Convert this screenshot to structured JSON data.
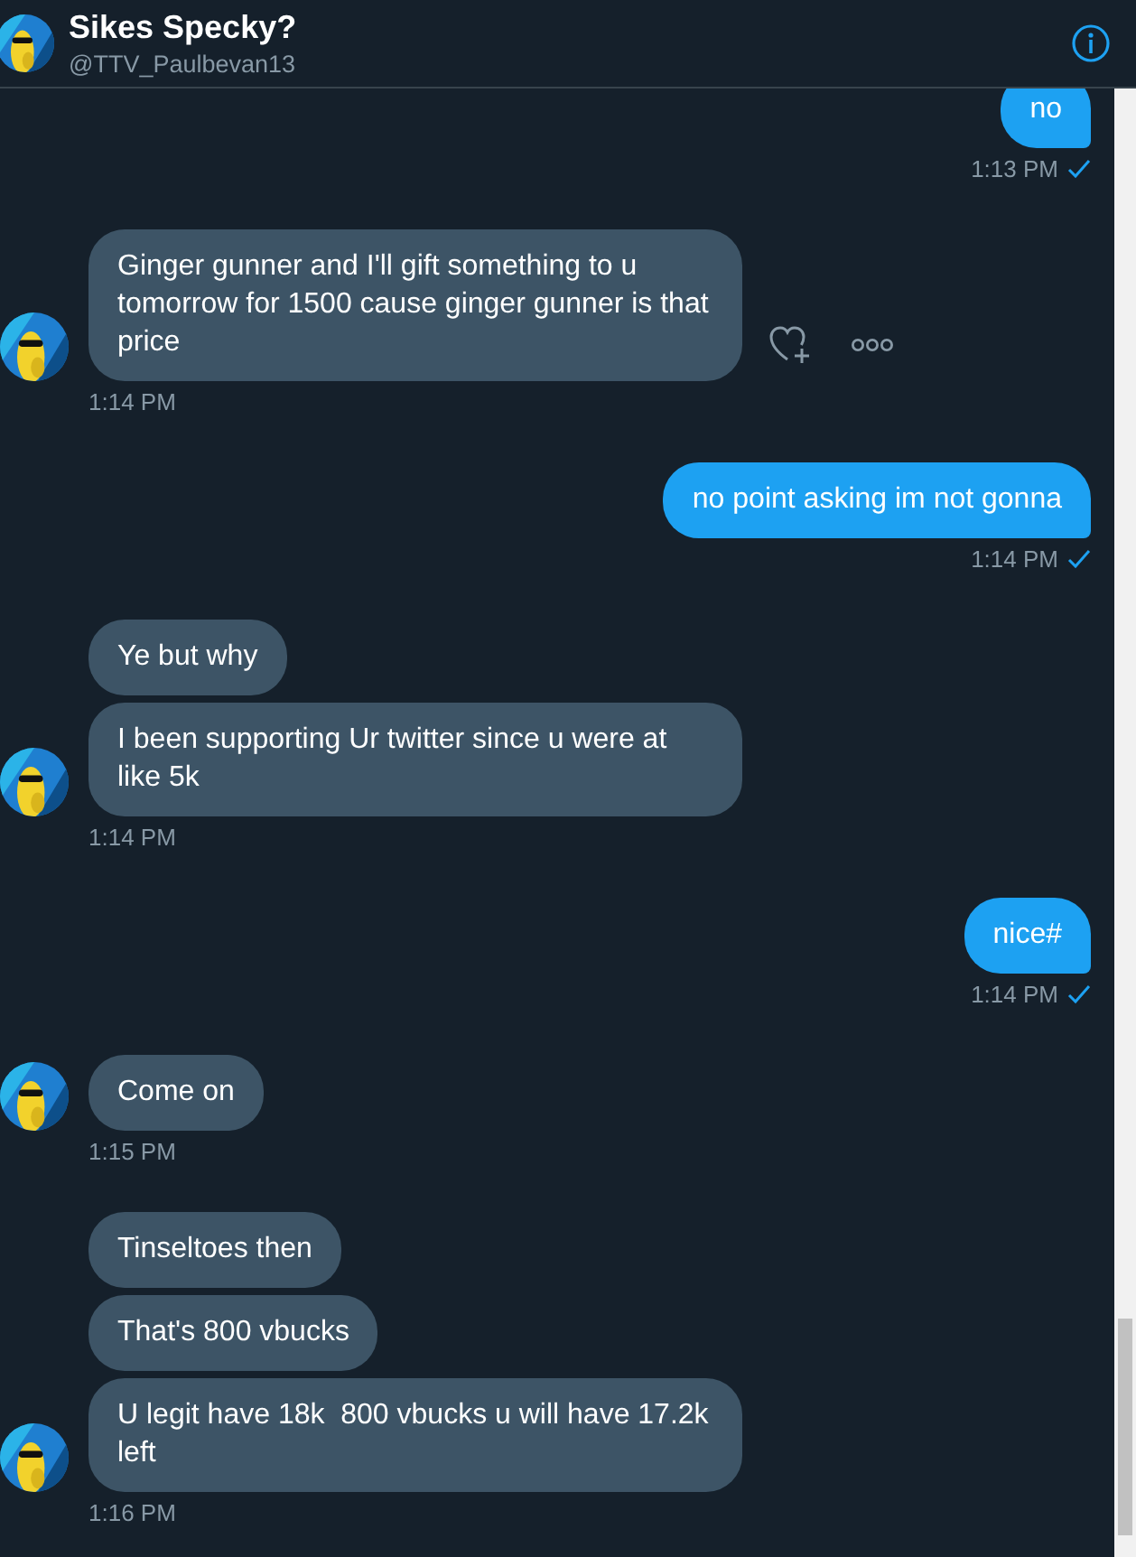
{
  "header": {
    "title": "Sikes Specky?",
    "handle": "@TTV_Paulbevan13"
  },
  "groups": [
    {
      "kind": "outgoing",
      "messages": [
        "no"
      ],
      "time": "1:13 PM",
      "read": true
    },
    {
      "kind": "incoming",
      "messages": [
        "Ginger gunner and I'll gift something to u tomorrow for 1500 cause ginger gunner is that price"
      ],
      "time": "1:14 PM",
      "hover_actions": true
    },
    {
      "kind": "outgoing",
      "messages": [
        "no point asking im not gonna"
      ],
      "time": "1:14 PM",
      "read": true
    },
    {
      "kind": "incoming",
      "messages": [
        "Ye but why",
        "I been supporting Ur twitter since u were at like 5k"
      ],
      "time": "1:14 PM",
      "hover_actions": false
    },
    {
      "kind": "outgoing",
      "messages": [
        "nice#"
      ],
      "time": "1:14 PM",
      "read": true
    },
    {
      "kind": "incoming",
      "messages": [
        "Come on"
      ],
      "time": "1:15 PM",
      "hover_actions": false
    },
    {
      "kind": "incoming",
      "messages": [
        "Tinseltoes then",
        "That's 800 vbucks",
        "U legit have 18k  800 vbucks u will have 17.2k left"
      ],
      "time": "1:16 PM",
      "hover_actions": false
    }
  ]
}
